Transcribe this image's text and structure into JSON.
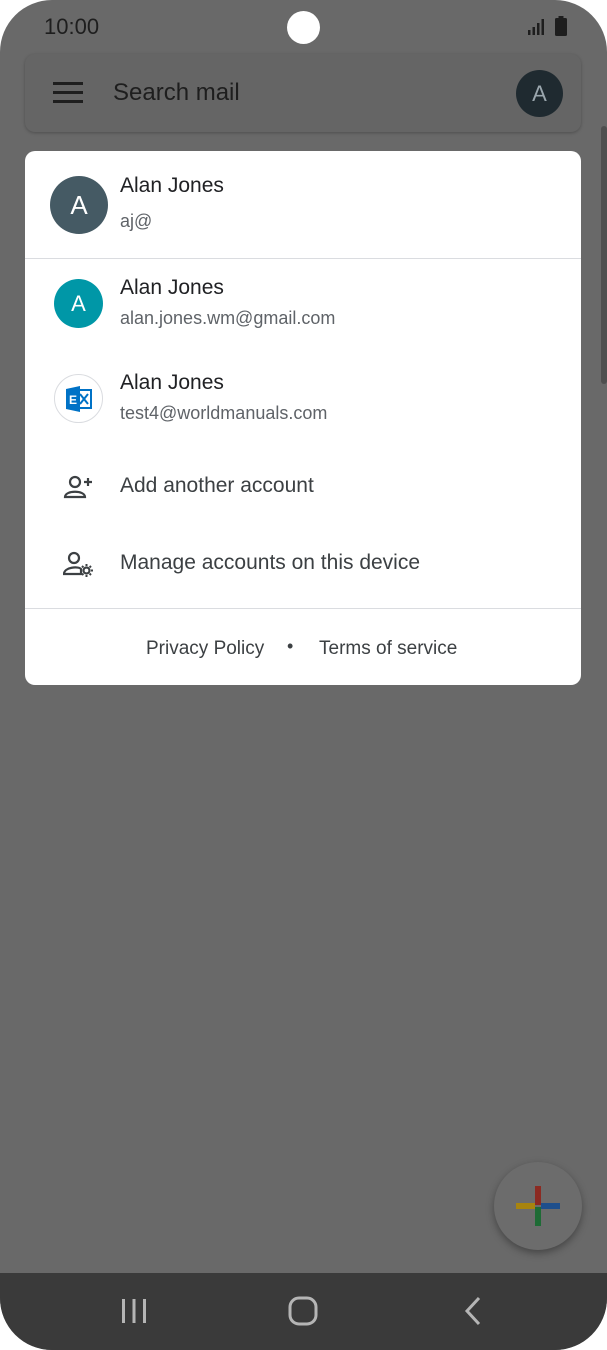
{
  "status_bar": {
    "time": "10:00",
    "icons": [
      "signal-icon",
      "battery-icon"
    ]
  },
  "search_bar": {
    "placeholder": "Search mail",
    "avatar_letter": "A"
  },
  "account_card": {
    "current_account": {
      "initial": "A",
      "name": "Alan Jones",
      "email": "aj@"
    },
    "accounts": [
      {
        "initial": "A",
        "name": "Alan Jones",
        "email": "alan.jones.wm@gmail.com",
        "avatar_color": "#0097a7"
      },
      {
        "icon": "exchange-icon",
        "name": "Alan Jones",
        "email": "test4@worldmanuals.com"
      }
    ],
    "actions": [
      {
        "icon": "add-person-icon",
        "label": "Add another account"
      },
      {
        "icon": "manage-accounts-icon",
        "label": "Manage accounts on this device"
      }
    ],
    "footer": {
      "privacy": "Privacy Policy",
      "separator": "•",
      "terms": "Terms of service"
    }
  },
  "fab": {
    "icon": "compose-plus-icon"
  },
  "nav_bar": {
    "icons": [
      "recent-apps-icon",
      "home-icon",
      "back-icon"
    ]
  },
  "colors": {
    "scrim": "#696969",
    "card": "#ffffff",
    "current_avatar": "#455a64",
    "teal_avatar": "#0097a7",
    "exchange_blue": "#0072c6"
  }
}
